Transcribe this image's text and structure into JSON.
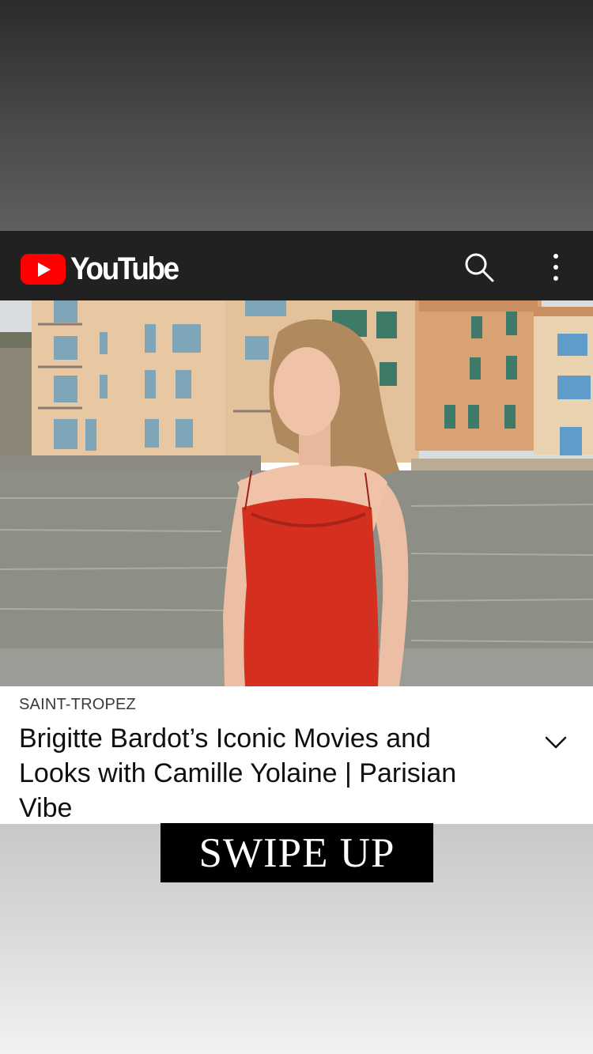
{
  "app": {
    "logo_text": "YouTube",
    "brand_color": "#FF0000",
    "header_background": "#212121",
    "icons": [
      "youtube-logo-icon",
      "search-icon",
      "more-vert-icon",
      "chevron-down-icon"
    ]
  },
  "video": {
    "thumbnail_description": "Woman in red slip dress standing by the water in front of pastel buildings",
    "channel_label": "SAINT-TROPEZ",
    "title": "Brigitte Bardot’s Iconic Movies and Looks with Camille Yolaine | Parisian Vibe"
  },
  "overlay": {
    "swipe_label": "SWIPE UP"
  }
}
